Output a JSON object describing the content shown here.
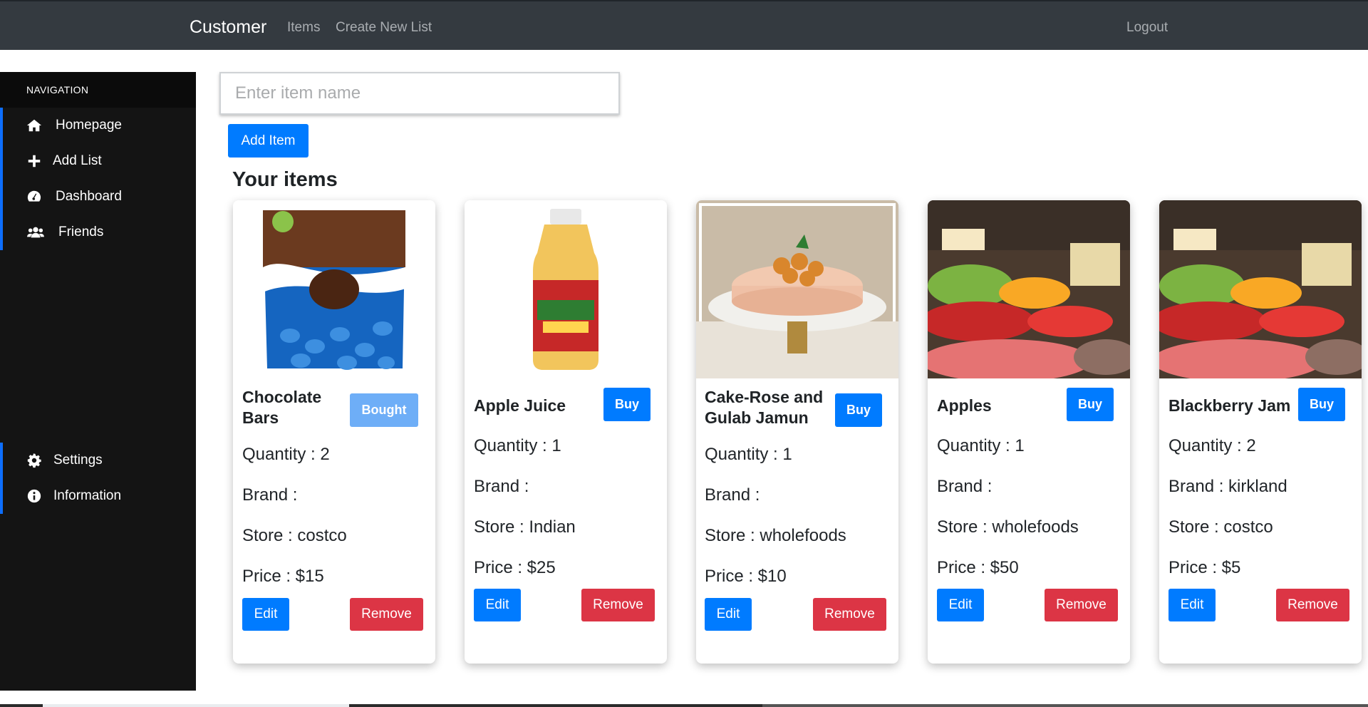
{
  "navbar": {
    "brand": "Customer",
    "links": [
      "Items",
      "Create New List"
    ],
    "logout": "Logout"
  },
  "sidebar": {
    "heading": "NAVIGATION",
    "items": [
      {
        "label": "Homepage",
        "icon": "home-icon"
      },
      {
        "label": "Add List",
        "icon": "plus-icon"
      },
      {
        "label": "Dashboard",
        "icon": "gauge-icon"
      },
      {
        "label": "Friends",
        "icon": "users-icon"
      }
    ],
    "bottom_items": [
      {
        "label": "Settings",
        "icon": "gear-icon"
      },
      {
        "label": "Information",
        "icon": "info-icon"
      }
    ]
  },
  "search": {
    "placeholder": "Enter item name",
    "value": ""
  },
  "add_button": "Add Item",
  "section_title": "Your items",
  "colors": {
    "primary": "#007bff",
    "danger": "#dc3545",
    "navbar": "#343a40",
    "sidebar": "#141414"
  },
  "labels": {
    "edit": "Edit",
    "remove": "Remove"
  },
  "items": [
    {
      "name_line1": "Chocolate",
      "name_line2": "Bars",
      "action": "Bought",
      "quantity": "Quantity : 2",
      "brand": "Brand :",
      "store": "Store : costco",
      "price": "Price : $15",
      "image": "chocolate-bag-image"
    },
    {
      "name_line1": "Apple Juice",
      "name_line2": "",
      "action": "Buy",
      "quantity": "Quantity : 1",
      "brand": "Brand :",
      "store": "Store : Indian",
      "price": "Price : $25",
      "image": "juice-bottle-image"
    },
    {
      "name_line1": "Cake-Rose and",
      "name_line2": "Gulab Jamun",
      "action": "Buy",
      "quantity": "Quantity : 1",
      "brand": "Brand :",
      "store": "Store : wholefoods",
      "price": "Price : $10",
      "image": "cake-image"
    },
    {
      "name_line1": "Apples",
      "name_line2": "",
      "action": "Buy",
      "quantity": "Quantity : 1",
      "brand": "Brand :",
      "store": "Store : wholefoods",
      "price": "Price : $50",
      "image": "produce-store-image"
    },
    {
      "name_line1": "Blackberry Jam",
      "name_line2": "",
      "action": "Buy",
      "quantity": "Quantity : 2",
      "brand": "Brand : kirkland",
      "store": "Store : costco",
      "price": "Price : $5",
      "image": "produce-store-image"
    }
  ]
}
